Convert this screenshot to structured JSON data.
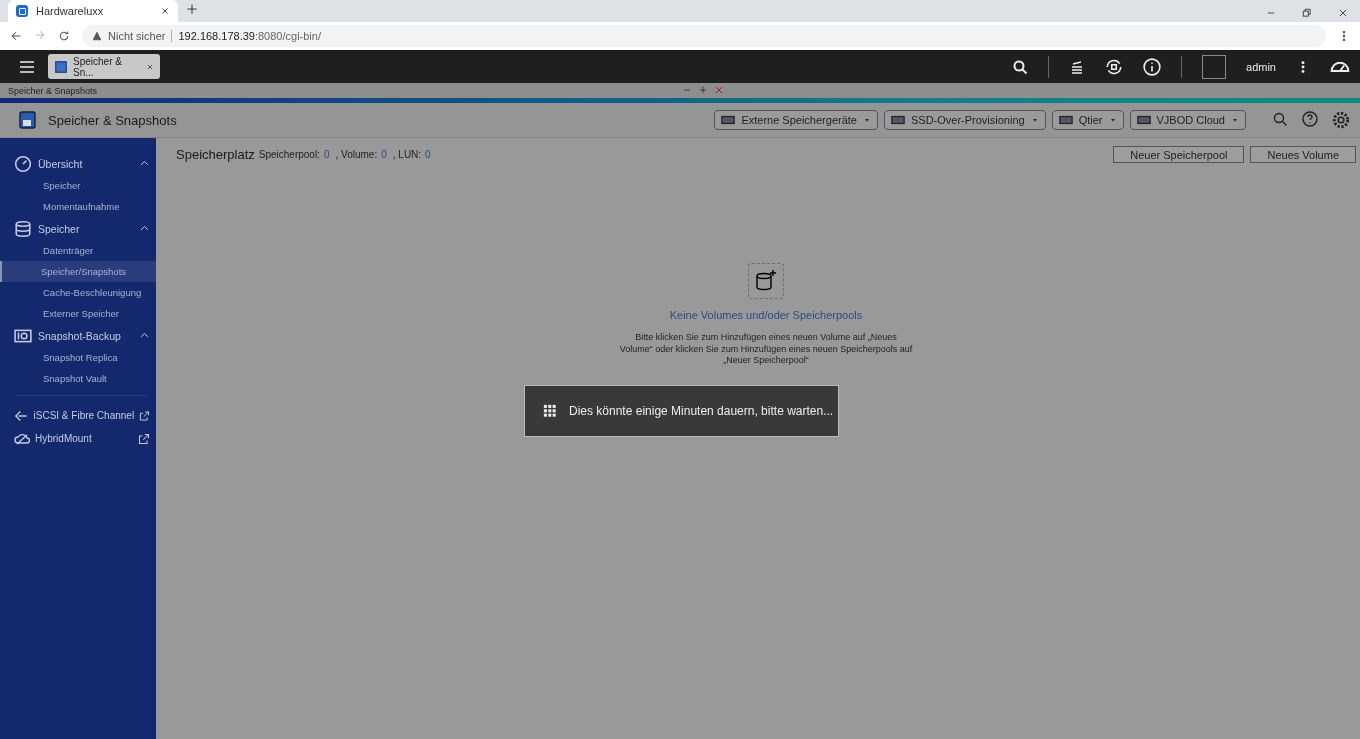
{
  "browser": {
    "tab_title": "Hardwareluxx",
    "security": "Nicht sicher",
    "host": "192.168.178.39",
    "path": ":8080/cgi-bin/"
  },
  "top_bar": {
    "app_tab": "Speicher & Sn...",
    "user": "admin"
  },
  "window": {
    "title": "Speicher & Snapshots"
  },
  "app_header": {
    "title": "Speicher & Snapshots",
    "tools": [
      {
        "label": "Externe Speichergeräte"
      },
      {
        "label": "SSD-Over-Provisioning"
      },
      {
        "label": "Qtier"
      },
      {
        "label": "VJBOD Cloud"
      }
    ]
  },
  "sidebar": {
    "groups": [
      {
        "title": "Übersicht",
        "expanded": true,
        "items": [
          {
            "label": "Speicher",
            "selected": false
          },
          {
            "label": "Momentaufnahme",
            "selected": false
          }
        ]
      },
      {
        "title": "Speicher",
        "expanded": true,
        "items": [
          {
            "label": "Datenträger",
            "selected": false
          },
          {
            "label": "Speicher/Snapshots",
            "selected": true
          },
          {
            "label": "Cache-Beschleunigung",
            "selected": false
          },
          {
            "label": "Externer Speicher",
            "selected": false
          }
        ]
      },
      {
        "title": "Snapshot-Backup",
        "expanded": true,
        "items": [
          {
            "label": "Snapshot Replica",
            "selected": false
          },
          {
            "label": "Snapshot Vault",
            "selected": false
          }
        ]
      }
    ],
    "links": [
      {
        "label": "iSCSI & Fibre Channel"
      },
      {
        "label": "HybridMount"
      }
    ]
  },
  "main": {
    "title": "Speicherplatz",
    "stats": [
      {
        "label": "Speicherpool:",
        "value": "0"
      },
      {
        "label": ", Volume:",
        "value": "0"
      },
      {
        "label": ", LUN:",
        "value": "0"
      }
    ],
    "buttons": [
      "Neuer Speicherpool",
      "Neues Volume"
    ],
    "empty_state": {
      "title": "Keine Volumes und/oder Speicherpools",
      "message": "Bitte klicken Sie zum Hinzufügen eines neuen Volume auf „Neues Volume“ oder klicken Sie zum Hinzufügen eines neuen Speicherpools auf „Neuer Speicherpool“"
    }
  },
  "loading": {
    "text": "Dies könnte einige Minuten dauern, bitte warten..."
  }
}
